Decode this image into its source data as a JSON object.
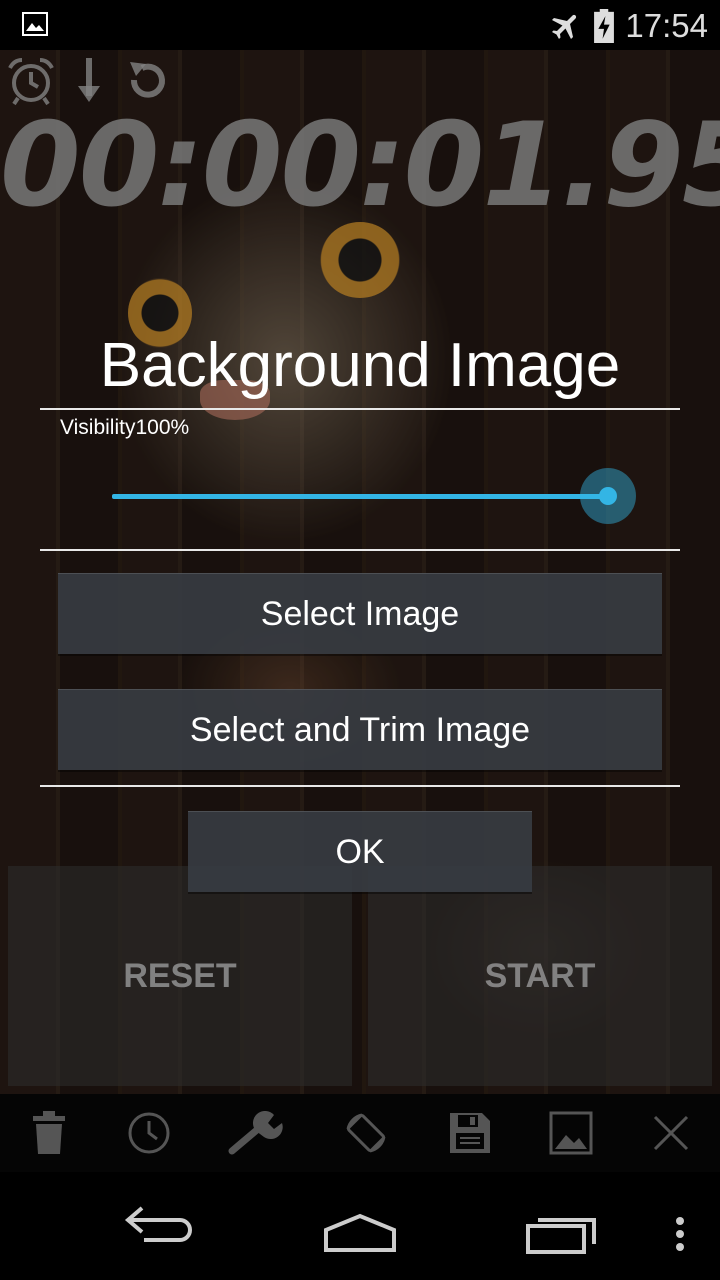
{
  "status_bar": {
    "time": "17:54",
    "icons": [
      "image-notification-icon",
      "airplane-mode-icon",
      "battery-charging-icon"
    ]
  },
  "stopwatch": {
    "time_display": "00:00:01.95",
    "top_icons": [
      "alarm-icon",
      "down-arrow-icon",
      "refresh-icon"
    ]
  },
  "dialog": {
    "title": "Background Image",
    "visibility_label": "Visibility",
    "visibility_value": "100%",
    "visibility_fraction": 1.0,
    "select_image_label": "Select Image",
    "select_trim_label": "Select and Trim Image",
    "ok_label": "OK"
  },
  "controls": {
    "reset_label": "RESET",
    "start_label": "START"
  },
  "toolbar": {
    "icons": [
      "trash-icon",
      "clock-icon",
      "wrench-icon",
      "rotate-screen-icon",
      "save-icon",
      "image-icon",
      "close-icon"
    ]
  },
  "navigation": {
    "icons": [
      "back-icon",
      "home-icon",
      "recents-icon",
      "overflow-menu-icon"
    ]
  },
  "colors": {
    "accent": "#33b5e5",
    "timer": "#787878"
  }
}
